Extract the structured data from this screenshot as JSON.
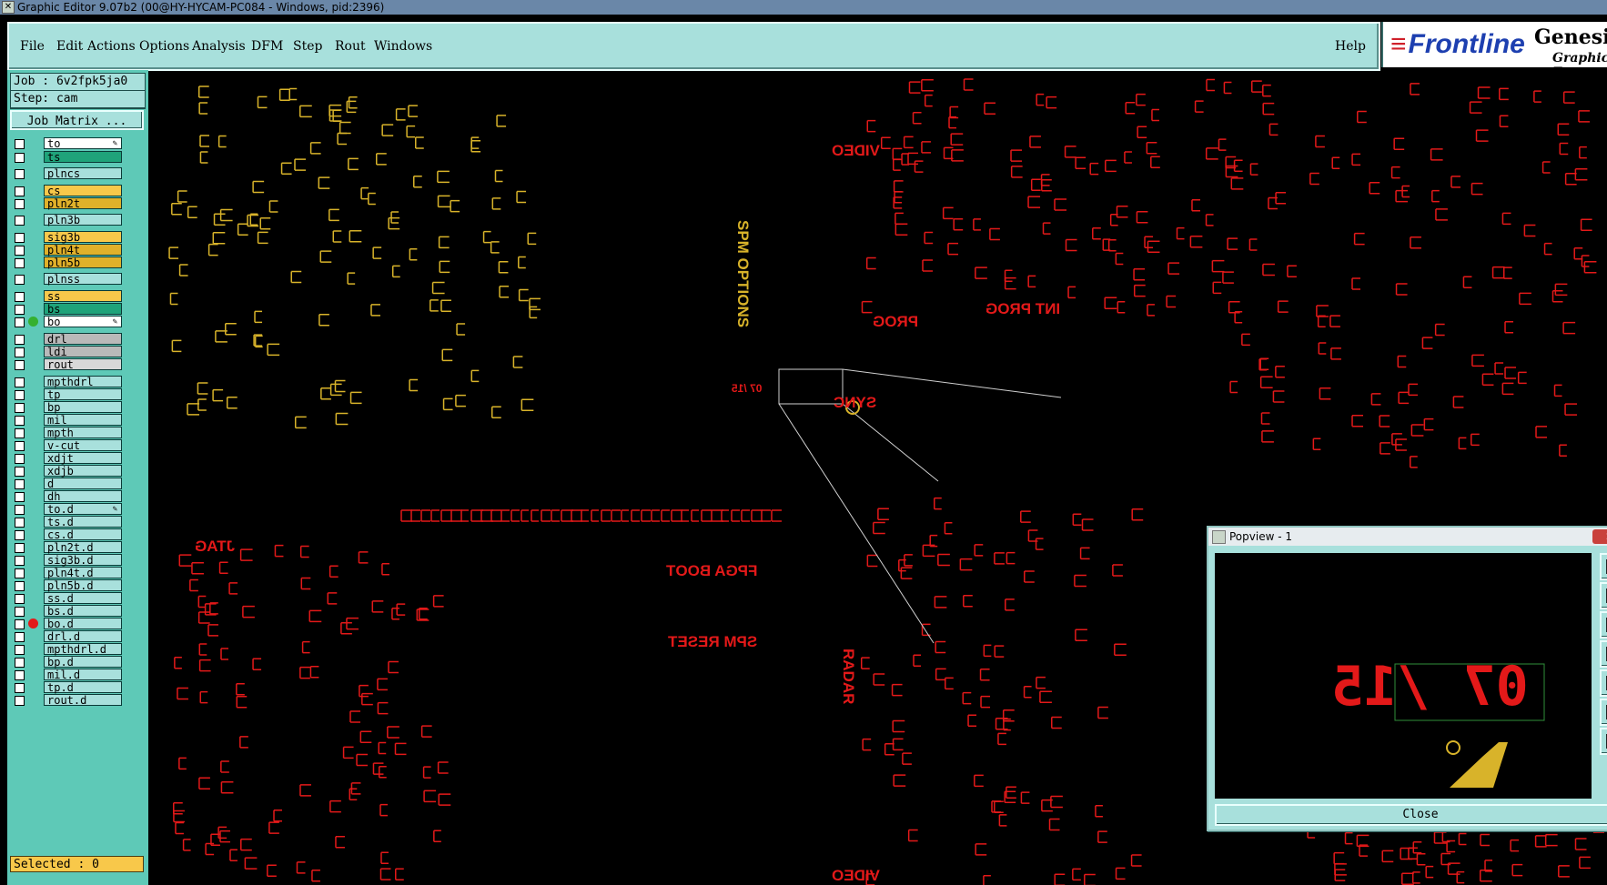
{
  "window": {
    "title": "Graphic Editor 9.07b2 (00@HY-HYCAM-PC084 - Windows, pid:2396)"
  },
  "menu": {
    "items": [
      "File",
      "Edit",
      "Actions",
      "Options",
      "Analysis",
      "DFM",
      "Step",
      "Rout",
      "Windows"
    ],
    "help": "Help"
  },
  "brand": {
    "logo": "Frontline",
    "product": "Genesis",
    "subtitle": "Graphic E"
  },
  "job": {
    "job_line": "Job : 6v2fpk5ja0",
    "step_line": "Step: cam",
    "matrix_button": "Job Matrix ..."
  },
  "layers": [
    {
      "name": "to",
      "color": "#ffffff",
      "edit": true
    },
    {
      "name": "ts",
      "color": "#1fa37a"
    },
    {
      "name": "plncs",
      "color": "#a8e0dc"
    },
    {
      "name": "cs",
      "color": "#f8c84a"
    },
    {
      "name": "pln2t",
      "color": "#e0b12a"
    },
    {
      "name": "pln3b",
      "color": "#a8e0dc"
    },
    {
      "name": "sig3b",
      "color": "#f8c84a"
    },
    {
      "name": "pln4t",
      "color": "#e0b12a"
    },
    {
      "name": "pln5b",
      "color": "#e0b12a"
    },
    {
      "name": "plnss",
      "color": "#a8e0dc"
    },
    {
      "name": "ss",
      "color": "#f8c84a"
    },
    {
      "name": "bs",
      "color": "#1fa37a"
    },
    {
      "name": "bo",
      "color": "#ffffff",
      "dot": "#35b030",
      "edit": true
    },
    {
      "name": "drl",
      "color": "#b9b9b9"
    },
    {
      "name": "ldi",
      "color": "#b9b9b9"
    },
    {
      "name": "rout",
      "color": "#d8d8d8"
    },
    {
      "name": "mpthdrl",
      "color": "#a8e0dc"
    },
    {
      "name": "tp",
      "color": "#a8e0dc"
    },
    {
      "name": "bp",
      "color": "#a8e0dc"
    },
    {
      "name": "mil",
      "color": "#a8e0dc"
    },
    {
      "name": "mpth",
      "color": "#a8e0dc"
    },
    {
      "name": "v-cut",
      "color": "#a8e0dc"
    },
    {
      "name": "xdjt",
      "color": "#a8e0dc"
    },
    {
      "name": "xdjb",
      "color": "#a8e0dc"
    },
    {
      "name": "d",
      "color": "#a8e0dc"
    },
    {
      "name": "dh",
      "color": "#a8e0dc"
    },
    {
      "name": "to.d",
      "color": "#a8e0dc",
      "edit": true
    },
    {
      "name": "ts.d",
      "color": "#a8e0dc"
    },
    {
      "name": "cs.d",
      "color": "#a8e0dc"
    },
    {
      "name": "pln2t.d",
      "color": "#a8e0dc"
    },
    {
      "name": "sig3b.d",
      "color": "#a8e0dc"
    },
    {
      "name": "pln4t.d",
      "color": "#a8e0dc"
    },
    {
      "name": "pln5b.d",
      "color": "#a8e0dc"
    },
    {
      "name": "ss.d",
      "color": "#a8e0dc"
    },
    {
      "name": "bs.d",
      "color": "#a8e0dc"
    },
    {
      "name": "bo.d",
      "color": "#a8e0dc",
      "dot": "#e31919"
    },
    {
      "name": "drl.d",
      "color": "#a8e0dc"
    },
    {
      "name": "mpthdrl.d",
      "color": "#a8e0dc"
    },
    {
      "name": "bp.d",
      "color": "#a8e0dc"
    },
    {
      "name": "mil.d",
      "color": "#a8e0dc"
    },
    {
      "name": "tp.d",
      "color": "#a8e0dc"
    },
    {
      "name": "rout.d",
      "color": "#a8e0dc"
    }
  ],
  "status": {
    "selected": "Selected : 0"
  },
  "silkscreen": {
    "video": "VIDEO",
    "spm_options": "SPM OPTIONS",
    "int_prog": "INT PROG",
    "prog": "PROG",
    "sync": "SYNC",
    "jtag": "JTAG",
    "fpga_boot": "FPGA BOOT",
    "spm_reset": "SPM RESET",
    "radar": "RADAR",
    "date_code": "07 /15",
    "video_bottom": "VIDEO"
  },
  "popview": {
    "title": "Popview - 1",
    "close_button": "Close",
    "zoom_text": "07 /15"
  },
  "colors": {
    "panel": "#a8e0dc",
    "accent": "#5ec9b7",
    "silk_red": "#e31919",
    "silk_yellow": "#d8b32a"
  }
}
